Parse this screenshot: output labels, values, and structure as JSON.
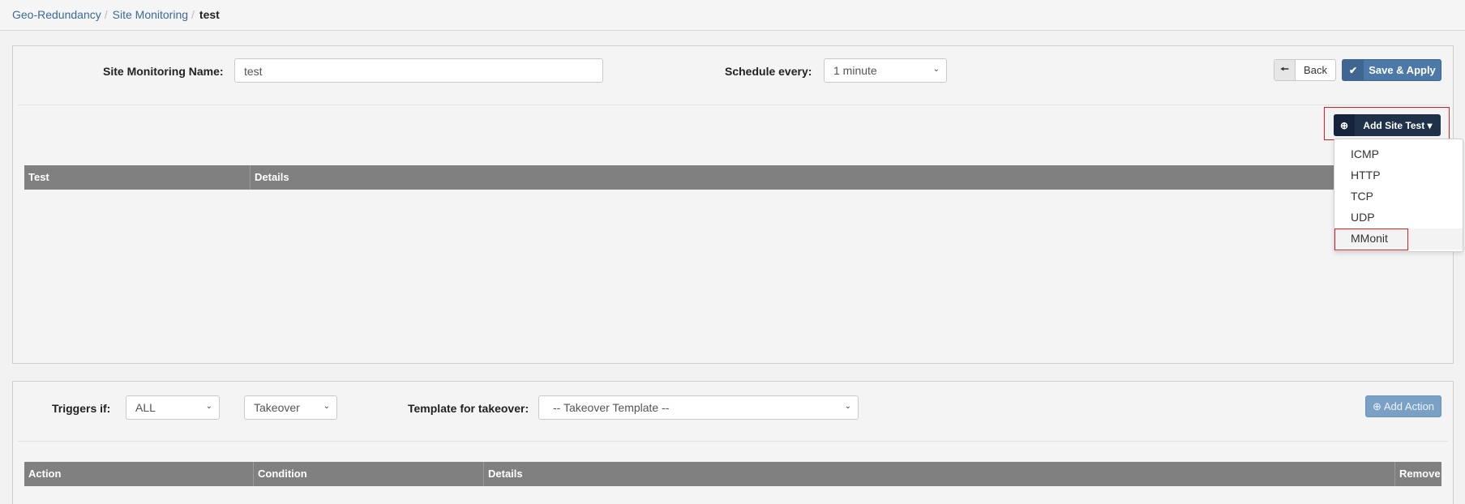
{
  "breadcrumb": {
    "items": [
      "Geo-Redundancy",
      "Site Monitoring"
    ],
    "current": "test",
    "separator": "/"
  },
  "form": {
    "name_label": "Site Monitoring Name:",
    "name_value": "test",
    "schedule_label": "Schedule every:",
    "schedule_value": "1 minute"
  },
  "toolbar": {
    "back_label": "Back",
    "save_label": "Save & Apply",
    "add_site_test_label": "Add Site Test"
  },
  "dropdown": {
    "items": [
      "ICMP",
      "HTTP",
      "TCP",
      "UDP",
      "MMonit"
    ],
    "highlighted": "MMonit"
  },
  "tests_table": {
    "columns": [
      "Test",
      "Details"
    ]
  },
  "triggers": {
    "label": "Triggers if:",
    "condition_value": "ALL",
    "action_value": "Takeover",
    "template_label": "Template for takeover:",
    "template_value": "-- Takeover Template --",
    "add_action_label": "Add Action"
  },
  "actions_table": {
    "columns": [
      "Action",
      "Condition",
      "Details",
      "Remove"
    ]
  },
  "icons": {
    "back": "arrow-left-icon",
    "save": "check-icon",
    "add": "plus-circle-icon",
    "caret": "caret-down-icon",
    "select_chevron": "chevron-down-icon"
  },
  "colors": {
    "link": "#3c6997",
    "save_button": "#4d79a8",
    "add_site_test_button": "#1f3249",
    "add_action_button": "#7aa0c6",
    "table_header": "#808080",
    "highlight": "#e02020"
  }
}
